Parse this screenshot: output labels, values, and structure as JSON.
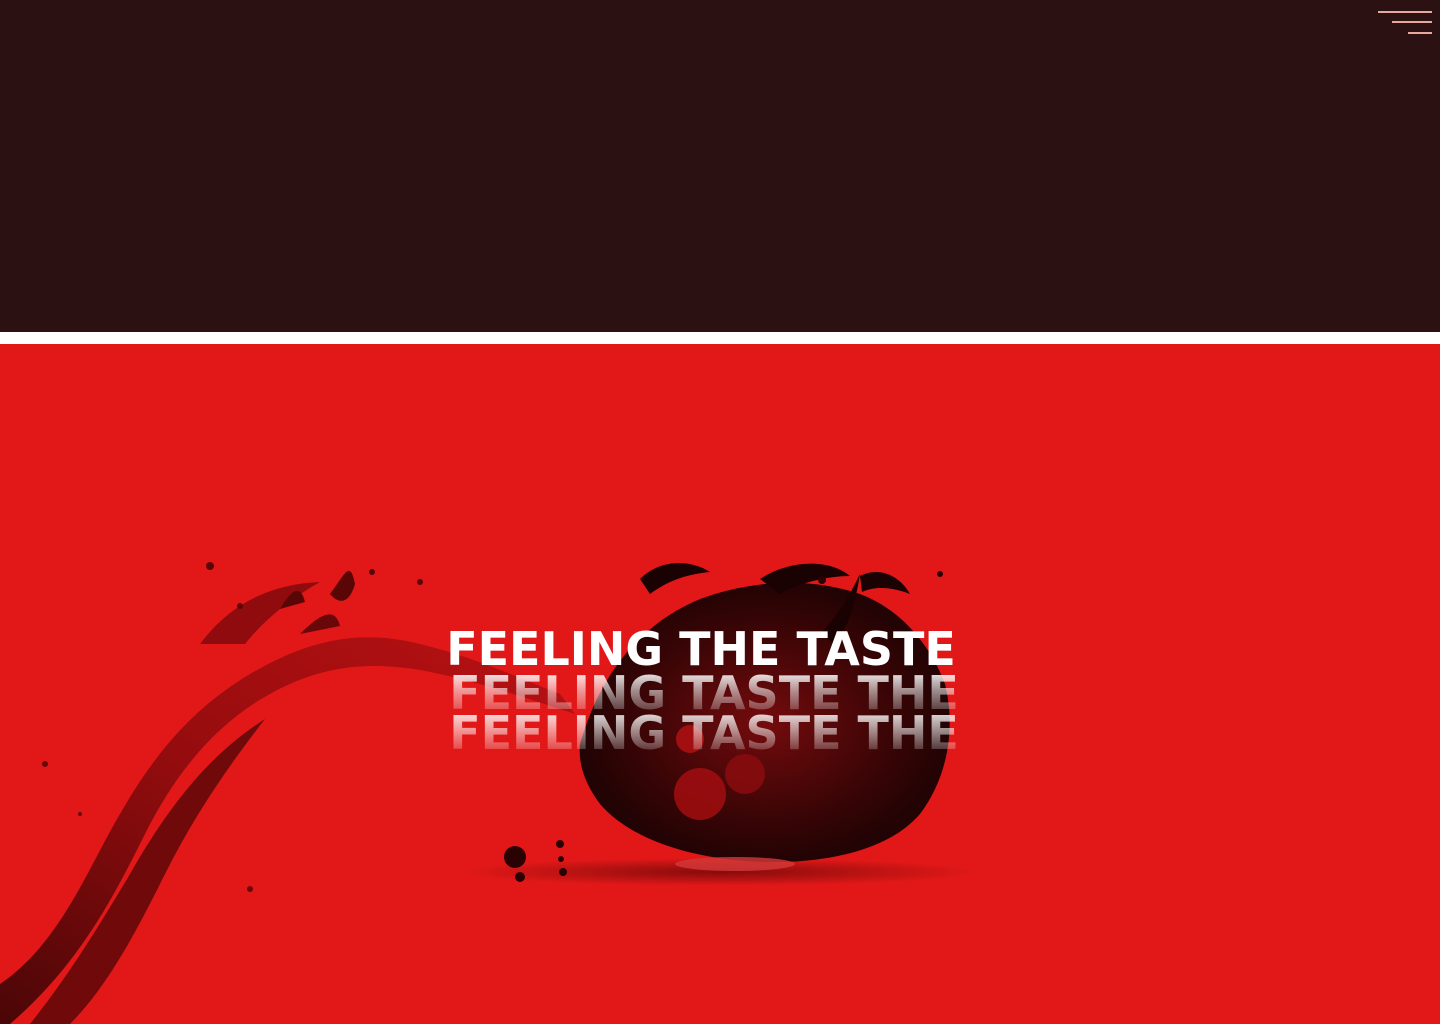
{
  "header": {
    "menu_icon": "hamburger-menu-icon",
    "background_color": "#2c1113",
    "accent_color": "#e8a79c"
  },
  "hero": {
    "background_color": "#e21818",
    "headline": "FEELING THE TASTE",
    "echo_lines": [
      "FEELING TASTE THE",
      "FEELING TASTE THE"
    ],
    "image": "wine-splash-illustration"
  }
}
